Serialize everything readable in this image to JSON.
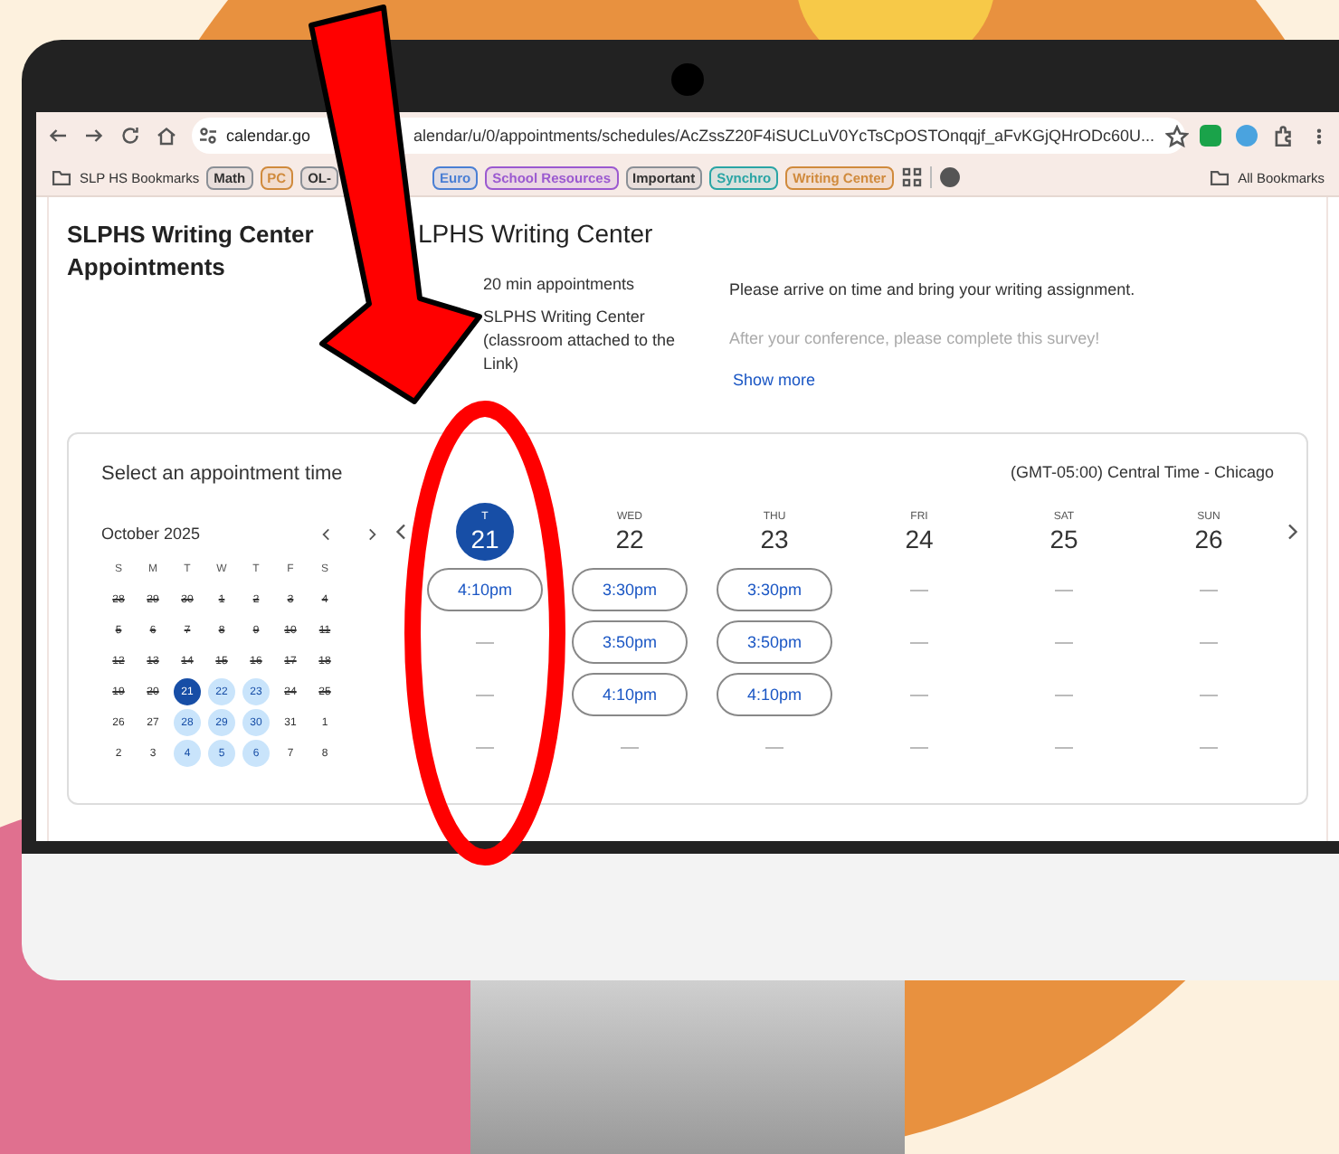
{
  "browser": {
    "url_parts": [
      "calendar.go",
      "alendar/u/0/appointments/schedules/AcZssZ20F4iSUCLuV0YcTsCpOSTOnqqjf_aFvKGjQHrODc60U..."
    ],
    "bookmarks": [
      {
        "kind": "folder",
        "label": "SLP HS Bookmarks"
      },
      {
        "kind": "chip",
        "label": "Math",
        "color": "#8a8f96"
      },
      {
        "kind": "chip",
        "label": "PC",
        "color": "#d08a3c"
      },
      {
        "kind": "chip",
        "label": "OL-",
        "color": "#8a8f96"
      },
      {
        "kind": "chip",
        "label": "Euro",
        "color": "#4a7fd4"
      },
      {
        "kind": "chip",
        "label": "School Resources",
        "color": "#9b59d0"
      },
      {
        "kind": "chip",
        "label": "Important",
        "color": "#8a8f96"
      },
      {
        "kind": "chip",
        "label": "Synchro",
        "color": "#2aa5a5"
      },
      {
        "kind": "chip",
        "label": "Writing Center",
        "color": "#d08a3c"
      }
    ],
    "all_bookmarks": "All Bookmarks"
  },
  "page": {
    "title": "SLPHS Writing Center Appointments",
    "schedule_title": "LPHS Writing Center",
    "details": [
      "20 min appointments",
      "SLPHS Writing Center (classroom attached to the Link)"
    ],
    "description": [
      {
        "text": "Please arrive on time and bring your writing assignment.",
        "faded": false
      },
      {
        "text": "After your conference, please complete this survey!",
        "faded": true
      }
    ],
    "show_more": "Show more"
  },
  "booking": {
    "heading": "Select an appointment time",
    "timezone": "(GMT-05:00) Central Time - Chicago",
    "month": {
      "title": "October 2025",
      "weekdays": [
        "S",
        "M",
        "T",
        "W",
        "T",
        "F",
        "S"
      ],
      "weeks": [
        [
          {
            "day": "28",
            "struck": true,
            "available": false,
            "selected": false
          },
          {
            "day": "29",
            "struck": true,
            "available": false,
            "selected": false
          },
          {
            "day": "30",
            "struck": true,
            "available": false,
            "selected": false
          },
          {
            "day": "1",
            "struck": true,
            "available": false,
            "selected": false
          },
          {
            "day": "2",
            "struck": true,
            "available": false,
            "selected": false
          },
          {
            "day": "3",
            "struck": true,
            "available": false,
            "selected": false
          },
          {
            "day": "4",
            "struck": true,
            "available": false,
            "selected": false
          }
        ],
        [
          {
            "day": "5",
            "struck": true,
            "available": false,
            "selected": false
          },
          {
            "day": "6",
            "struck": true,
            "available": false,
            "selected": false
          },
          {
            "day": "7",
            "struck": true,
            "available": false,
            "selected": false
          },
          {
            "day": "8",
            "struck": true,
            "available": false,
            "selected": false
          },
          {
            "day": "9",
            "struck": true,
            "available": false,
            "selected": false
          },
          {
            "day": "10",
            "struck": true,
            "available": false,
            "selected": false
          },
          {
            "day": "11",
            "struck": true,
            "available": false,
            "selected": false
          }
        ],
        [
          {
            "day": "12",
            "struck": true,
            "available": false,
            "selected": false
          },
          {
            "day": "13",
            "struck": true,
            "available": false,
            "selected": false
          },
          {
            "day": "14",
            "struck": true,
            "available": false,
            "selected": false
          },
          {
            "day": "15",
            "struck": true,
            "available": false,
            "selected": false
          },
          {
            "day": "16",
            "struck": true,
            "available": false,
            "selected": false
          },
          {
            "day": "17",
            "struck": true,
            "available": false,
            "selected": false
          },
          {
            "day": "18",
            "struck": true,
            "available": false,
            "selected": false
          }
        ],
        [
          {
            "day": "19",
            "struck": true,
            "available": false,
            "selected": false
          },
          {
            "day": "20",
            "struck": true,
            "available": false,
            "selected": false
          },
          {
            "day": "21",
            "struck": false,
            "available": true,
            "selected": true
          },
          {
            "day": "22",
            "struck": false,
            "available": true,
            "selected": false
          },
          {
            "day": "23",
            "struck": false,
            "available": true,
            "selected": false
          },
          {
            "day": "24",
            "struck": true,
            "available": false,
            "selected": false
          },
          {
            "day": "25",
            "struck": true,
            "available": false,
            "selected": false
          }
        ],
        [
          {
            "day": "26",
            "struck": false,
            "available": false,
            "selected": false
          },
          {
            "day": "27",
            "struck": false,
            "available": false,
            "selected": false
          },
          {
            "day": "28",
            "struck": false,
            "available": true,
            "selected": false
          },
          {
            "day": "29",
            "struck": false,
            "available": true,
            "selected": false
          },
          {
            "day": "30",
            "struck": false,
            "available": true,
            "selected": false
          },
          {
            "day": "31",
            "struck": false,
            "available": false,
            "selected": false
          },
          {
            "day": "1",
            "struck": false,
            "available": false,
            "selected": false
          }
        ],
        [
          {
            "day": "2",
            "struck": false,
            "available": false,
            "selected": false
          },
          {
            "day": "3",
            "struck": false,
            "available": false,
            "selected": false
          },
          {
            "day": "4",
            "struck": false,
            "available": true,
            "selected": false
          },
          {
            "day": "5",
            "struck": false,
            "available": true,
            "selected": false
          },
          {
            "day": "6",
            "struck": false,
            "available": true,
            "selected": false
          },
          {
            "day": "7",
            "struck": false,
            "available": false,
            "selected": false
          },
          {
            "day": "8",
            "struck": false,
            "available": false,
            "selected": false
          }
        ]
      ]
    },
    "days": [
      {
        "weekday": "T",
        "date": "21",
        "selected": true,
        "slots": [
          {
            "kind": "time",
            "label": "4:10pm"
          },
          {
            "kind": "empty"
          },
          {
            "kind": "empty"
          },
          {
            "kind": "empty"
          }
        ]
      },
      {
        "weekday": "WED",
        "date": "22",
        "selected": false,
        "slots": [
          {
            "kind": "time",
            "label": "3:30pm"
          },
          {
            "kind": "time",
            "label": "3:50pm"
          },
          {
            "kind": "time",
            "label": "4:10pm"
          },
          {
            "kind": "empty"
          }
        ]
      },
      {
        "weekday": "THU",
        "date": "23",
        "selected": false,
        "slots": [
          {
            "kind": "time",
            "label": "3:30pm"
          },
          {
            "kind": "time",
            "label": "3:50pm"
          },
          {
            "kind": "time",
            "label": "4:10pm"
          },
          {
            "kind": "empty"
          }
        ]
      },
      {
        "weekday": "FRI",
        "date": "24",
        "selected": false,
        "slots": [
          {
            "kind": "empty"
          },
          {
            "kind": "empty"
          },
          {
            "kind": "empty"
          },
          {
            "kind": "empty"
          }
        ]
      },
      {
        "weekday": "SAT",
        "date": "25",
        "selected": false,
        "slots": [
          {
            "kind": "empty"
          },
          {
            "kind": "empty"
          },
          {
            "kind": "empty"
          },
          {
            "kind": "empty"
          }
        ]
      },
      {
        "weekday": "SUN",
        "date": "26",
        "selected": false,
        "slots": [
          {
            "kind": "empty"
          },
          {
            "kind": "empty"
          },
          {
            "kind": "empty"
          },
          {
            "kind": "empty"
          }
        ]
      }
    ]
  }
}
